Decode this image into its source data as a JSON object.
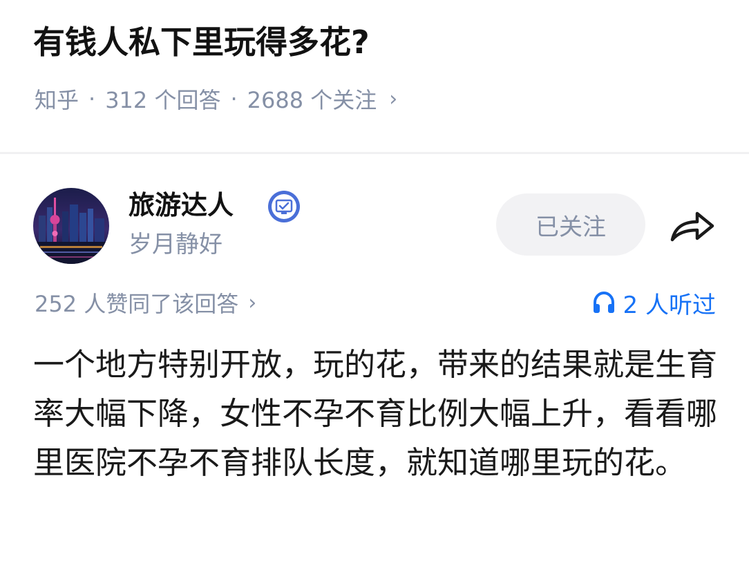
{
  "question": {
    "title": "有钱人私下里玩得多花?",
    "source": "知乎",
    "separator": "·",
    "answers_count": "312 个回答",
    "followers_count": "2688 个关注",
    "chevron": "›"
  },
  "author": {
    "name": "旅游达人",
    "bio": "岁月静好",
    "avatar_icon": "avatar-city-night",
    "verified_icon": "verified-badge-icon",
    "follow_label": "已关注",
    "share_icon": "share-arrow-icon"
  },
  "stats": {
    "likes_text": "252 人赞同了该回答",
    "chevron": "›",
    "listen_text": "2 人听过",
    "listen_icon": "headphones-icon"
  },
  "answer": {
    "content": "一个地方特别开放，玩的花，带来的结果就是生育率大幅下降，女性不孕不育比例大幅上升，看看哪里医院不孕不育排队长度，就知道哪里玩的花。"
  },
  "colors": {
    "title": "#121212",
    "meta_gray": "#8590a6",
    "accent_blue": "#1772f6",
    "button_bg": "#f2f2f4",
    "divider": "#f0f0f2"
  }
}
